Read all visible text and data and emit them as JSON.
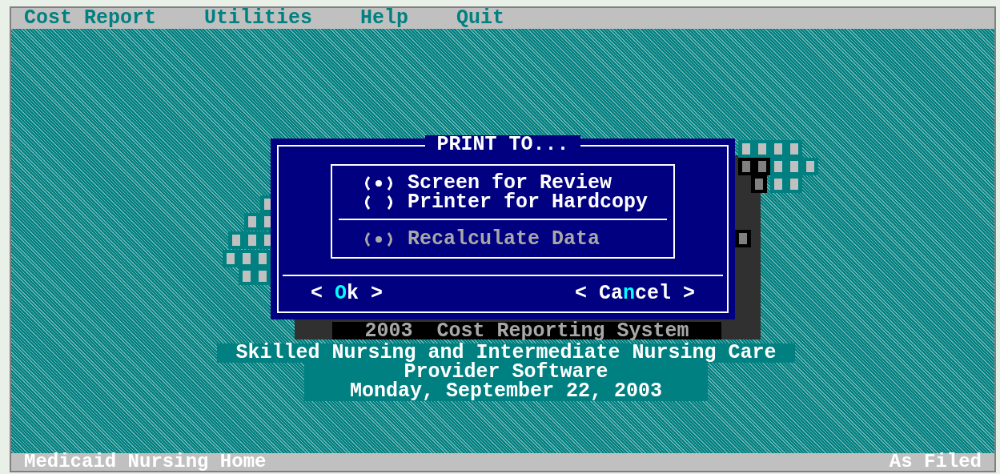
{
  "menu": [
    "Cost Report",
    "Utilities",
    "Help",
    "Quit"
  ],
  "dialog": {
    "title": "PRINT TO...",
    "options": [
      {
        "label": "Screen for Review",
        "checked": true,
        "disabled": false
      },
      {
        "label": "Printer for Hardcopy",
        "checked": false,
        "disabled": false
      }
    ],
    "extra_option": {
      "label": "Recalculate Data",
      "checked": true,
      "disabled": true
    },
    "buttons": [
      {
        "segments": [
          {
            "text": "< ",
            "hotkey": false
          },
          {
            "text": "O",
            "hotkey": true
          },
          {
            "text": "k >",
            "hotkey": false
          }
        ]
      },
      {
        "segments": [
          {
            "text": "< Ca",
            "hotkey": false
          },
          {
            "text": "n",
            "hotkey": true
          },
          {
            "text": "cel >",
            "hotkey": false
          }
        ]
      }
    ]
  },
  "banner": "2003  Cost Reporting System",
  "title_lines": [
    "Skilled Nursing and Intermediate Nursing Care",
    "Provider Software",
    "Monday, September 22, 2003"
  ],
  "status_bar": {
    "left": "Medicaid Nursing Home",
    "right": "As Filed"
  }
}
